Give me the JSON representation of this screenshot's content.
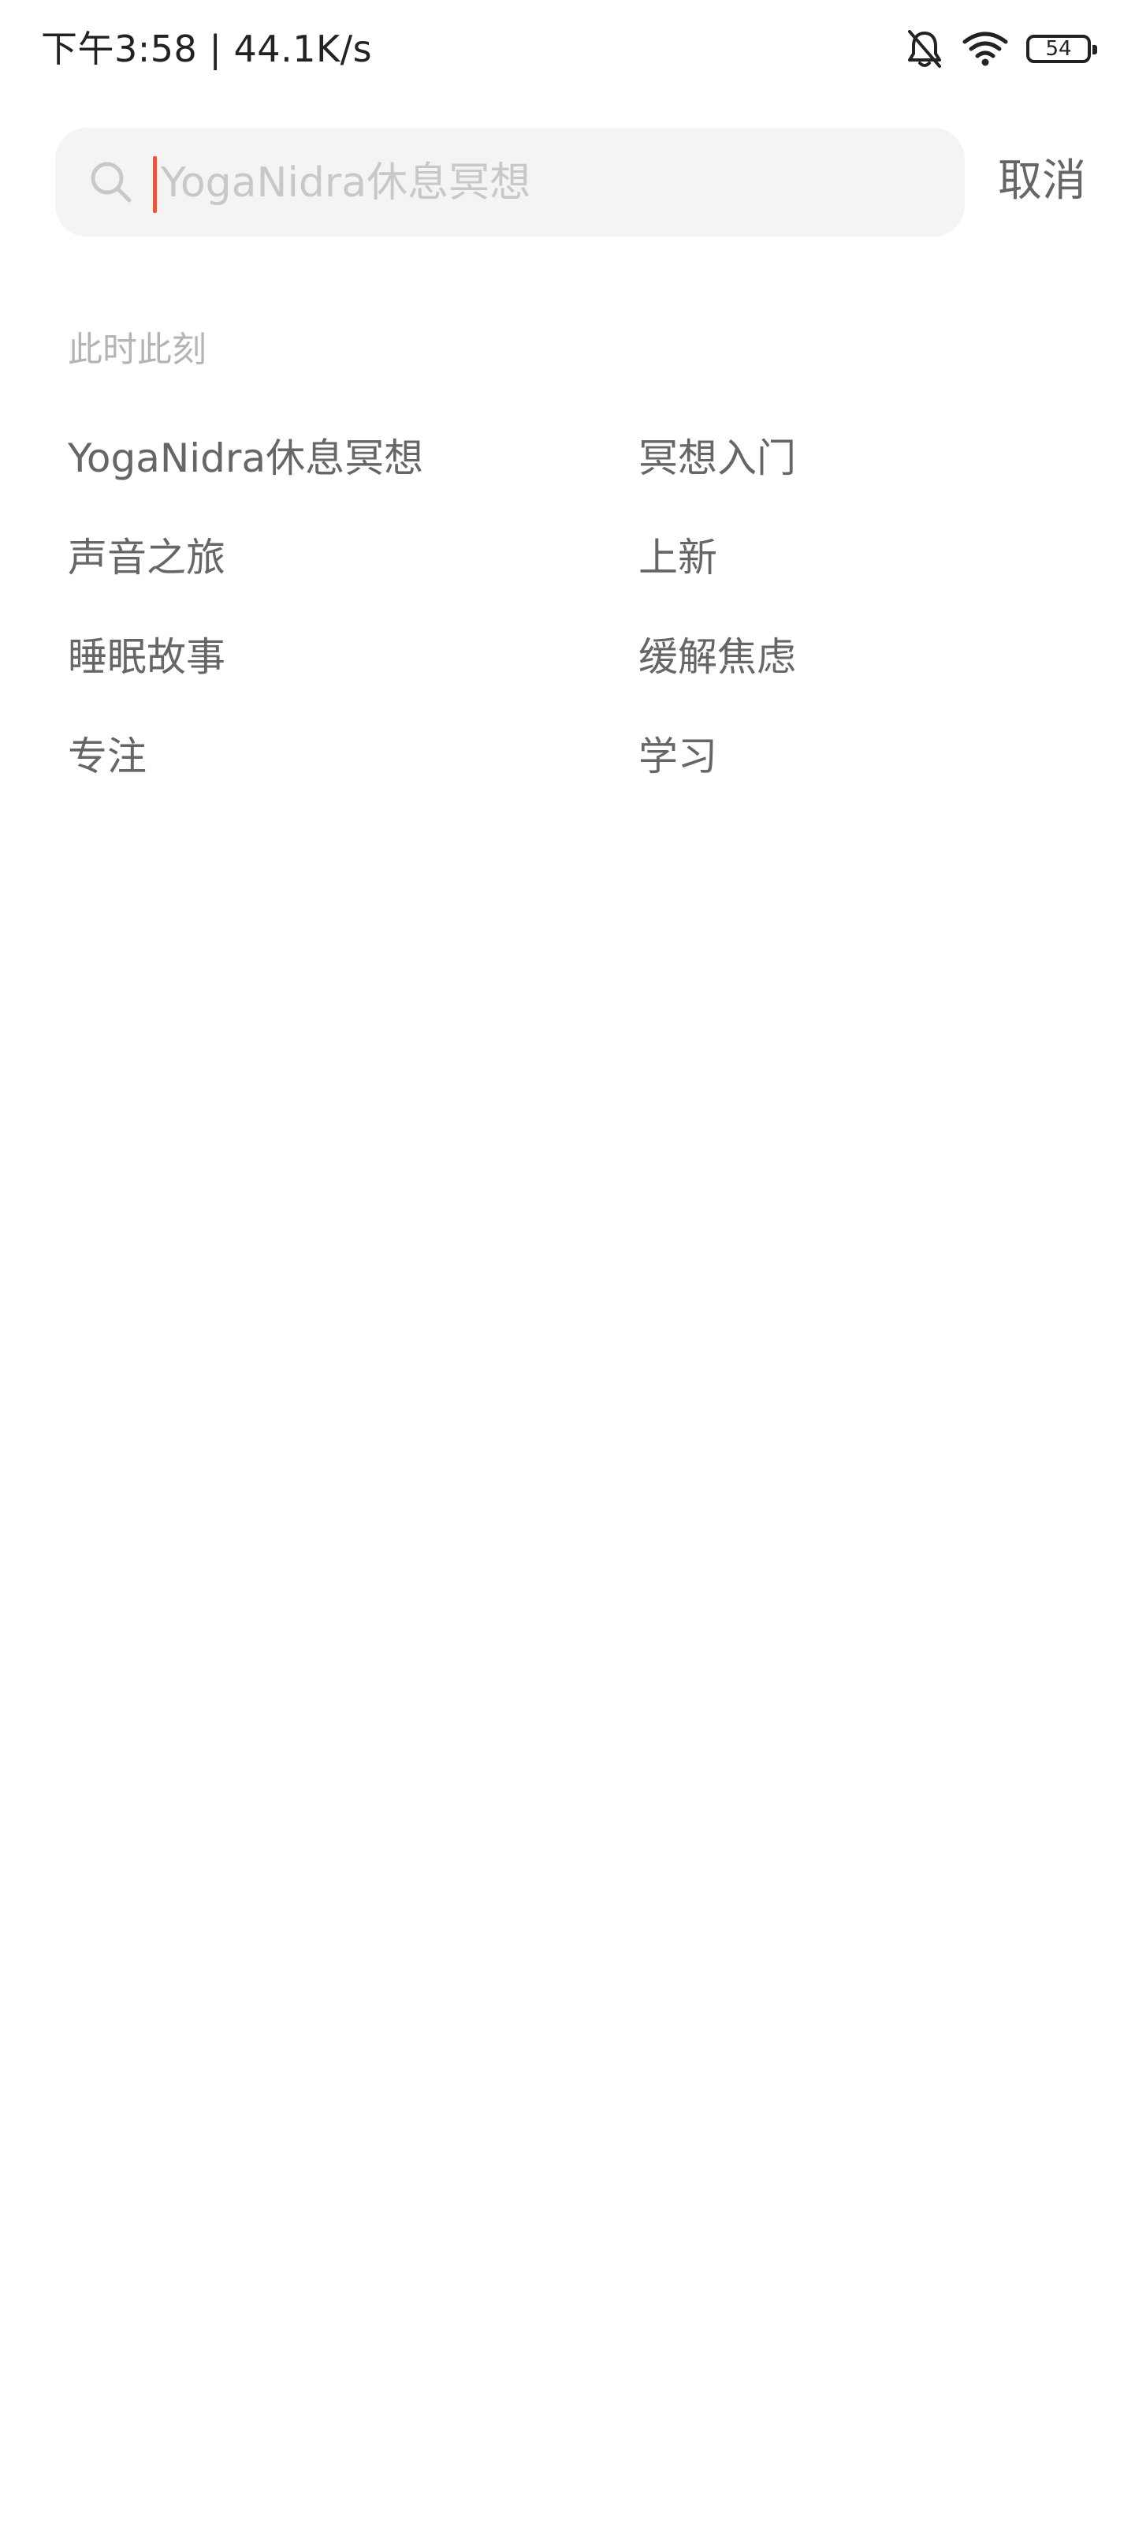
{
  "status_bar": {
    "time_speed": "下午3:58 | 44.1K/s",
    "icons": [
      "bell-off-icon",
      "wifi-icon",
      "battery-icon"
    ],
    "battery_level": "54"
  },
  "search": {
    "placeholder": "YogaNidra休息冥想",
    "value": "",
    "caret_color": "#e8553d",
    "cancel_label": "取消",
    "icon": "search-icon"
  },
  "section": {
    "title": "此时此刻",
    "suggestions": [
      "YogaNidra休息冥想",
      "冥想入门",
      "声音之旅",
      "上新",
      "睡眠故事",
      "缓解焦虑",
      "专注",
      "学习"
    ]
  }
}
